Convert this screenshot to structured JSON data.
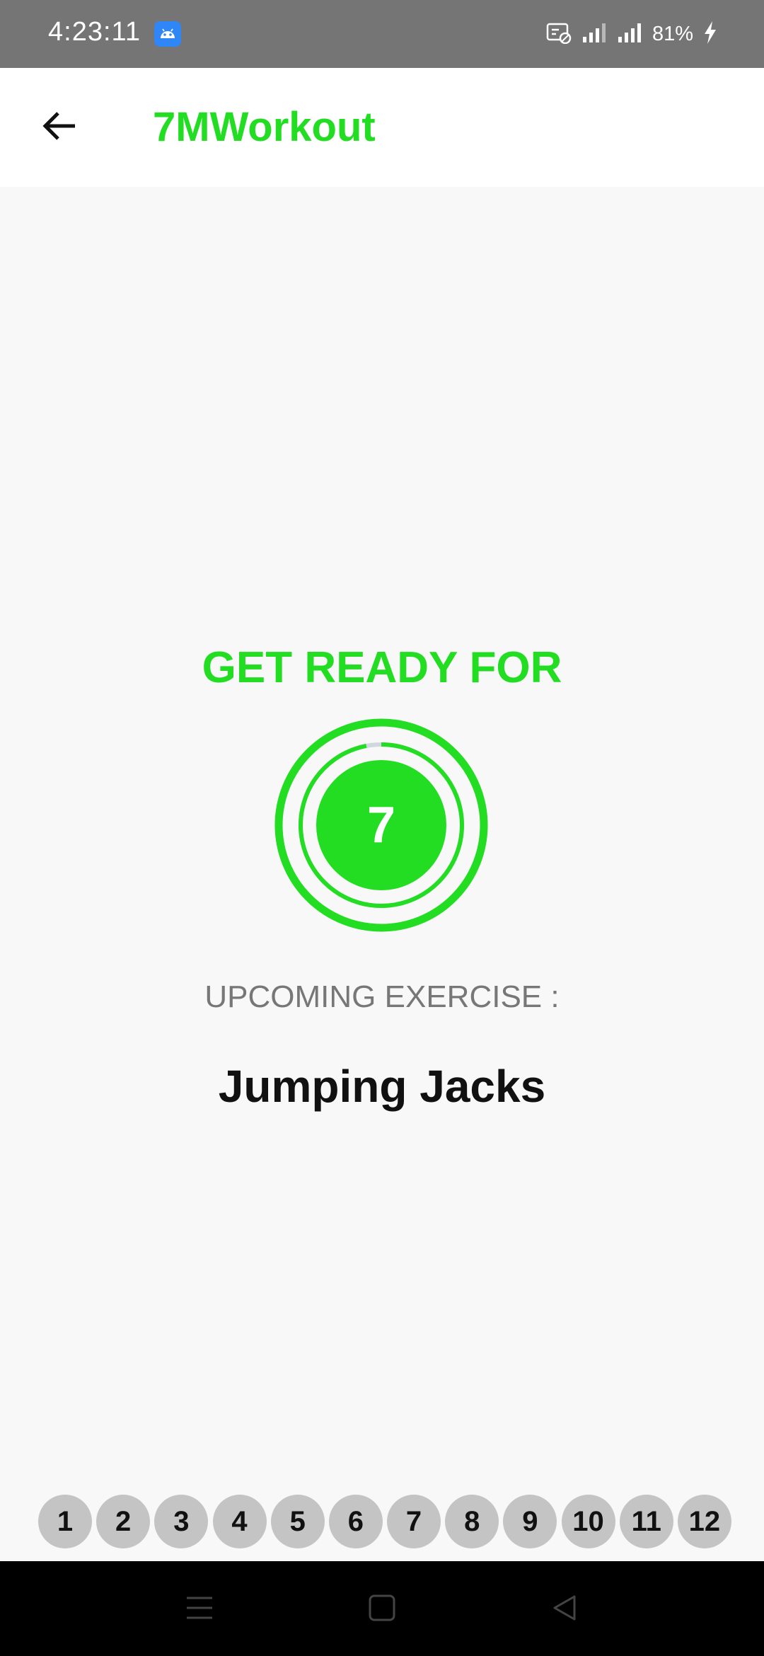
{
  "status_bar": {
    "time": "4:23:11",
    "battery": "81%",
    "icons": [
      "android-icon",
      "screenshot-icon",
      "signal-icon",
      "signal-icon",
      "charging-icon"
    ]
  },
  "app_bar": {
    "title": "7MWorkout",
    "back_icon": "arrow-back-icon"
  },
  "main": {
    "heading": "GET READY FOR",
    "timer_value": "7",
    "timer_progress": 0.97,
    "upcoming_label": "UPCOMING EXERCISE :",
    "exercise_name": "Jumping Jacks"
  },
  "exercise_indicators": [
    "1",
    "2",
    "3",
    "4",
    "5",
    "6",
    "7",
    "8",
    "9",
    "10",
    "11",
    "12"
  ],
  "nav_bar": {
    "buttons": [
      "menu-icon",
      "home-icon",
      "back-triangle-icon"
    ]
  },
  "colors": {
    "accent": "#22dd22",
    "status_bar": "#757575",
    "background": "#f8f8f8",
    "indicator": "#c4c4c4",
    "progress_track": "#cfd8dc"
  }
}
